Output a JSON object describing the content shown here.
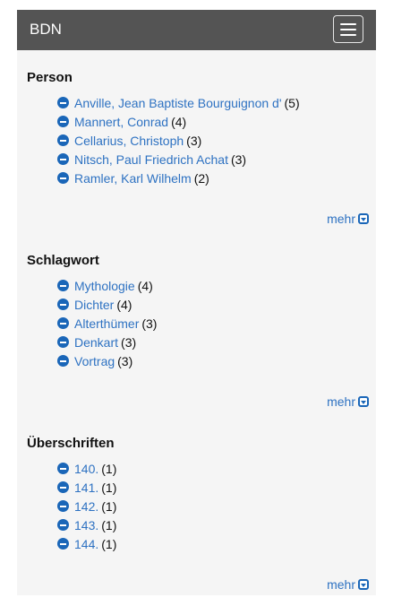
{
  "navbar": {
    "brand": "BDN",
    "menu_icon": "hamburger-menu-icon"
  },
  "sections": [
    {
      "title": "Person",
      "items": [
        {
          "label": "Anville, Jean Baptiste Bourguignon d'",
          "count": "(5)"
        },
        {
          "label": "Mannert, Conrad",
          "count": "(4)"
        },
        {
          "label": "Cellarius, Christoph",
          "count": "(3)"
        },
        {
          "label": "Nitsch, Paul Friedrich Achat",
          "count": "(3)"
        },
        {
          "label": "Ramler, Karl Wilhelm",
          "count": "(2)"
        }
      ],
      "more_label": "mehr"
    },
    {
      "title": "Schlagwort",
      "items": [
        {
          "label": "Mythologie",
          "count": "(4)"
        },
        {
          "label": "Dichter",
          "count": "(4)"
        },
        {
          "label": "Alterthümer",
          "count": "(3)"
        },
        {
          "label": "Denkart",
          "count": "(3)"
        },
        {
          "label": "Vortrag",
          "count": "(3)"
        }
      ],
      "more_label": "mehr"
    },
    {
      "title": "Überschriften",
      "items": [
        {
          "label": "140.",
          "count": "(1)"
        },
        {
          "label": "141.",
          "count": "(1)"
        },
        {
          "label": "142.",
          "count": "(1)"
        },
        {
          "label": "143.",
          "count": "(1)"
        },
        {
          "label": "144.",
          "count": "(1)"
        }
      ],
      "more_label": "mehr"
    }
  ]
}
